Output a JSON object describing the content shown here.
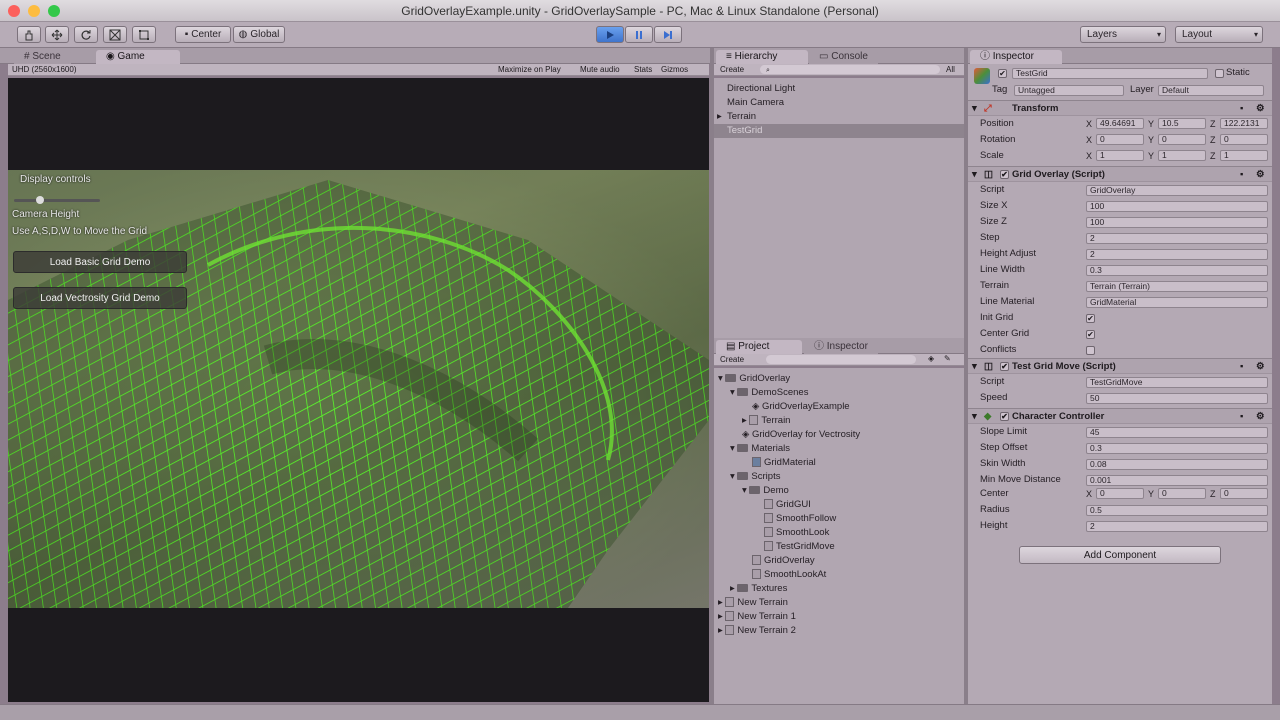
{
  "window": {
    "title": "GridOverlayExample.unity - GridOverlaySample - PC, Mac & Linux Standalone (Personal)"
  },
  "toolbar": {
    "pivot": "Center",
    "space": "Global",
    "layers": "Layers",
    "layout": "Layout"
  },
  "scene_tabs": {
    "scene": "Scene",
    "game": "Game"
  },
  "game_bar": {
    "resolution": "UHD (2560x1600)",
    "maximize": "Maximize on Play",
    "mute": "Mute audio",
    "stats": "Stats",
    "gizmos": "Gizmos"
  },
  "game_hud": {
    "display_controls": "Display controls",
    "camera_height": "Camera Height",
    "move_hint": "Use A,S,D,W to Move the Grid",
    "btn_basic": "Load Basic Grid Demo",
    "btn_vectrosity": "Load Vectrosity Grid Demo",
    "camera_slider_level": 0.3
  },
  "hierarchy": {
    "tab": "Hierarchy",
    "tab2": "Console",
    "create": "Create",
    "search_placeholder": "All",
    "items": [
      "Directional Light",
      "Main Camera",
      "Terrain",
      "TestGrid"
    ]
  },
  "project": {
    "tab": "Project",
    "tab2": "Inspector",
    "create": "Create",
    "tree": [
      "GridOverlay",
      "DemoScenes",
      "GridOverlayExample",
      "Terrain",
      "GridOverlay for Vectrosity",
      "Materials",
      "GridMaterial",
      "Scripts",
      "Demo",
      "GridGUI",
      "SmoothFollow",
      "SmoothLook",
      "TestGridMove",
      "GridOverlay",
      "SmoothLookAt",
      "Textures",
      "New Terrain",
      "New Terrain 1",
      "New Terrain 2"
    ]
  },
  "inspector": {
    "tab": "Inspector",
    "object_name": "TestGrid",
    "static_label": "Static",
    "tag_label": "Tag",
    "tag_value": "Untagged",
    "layer_label": "Layer",
    "layer_value": "Default",
    "transform": {
      "title": "Transform",
      "position_label": "Position",
      "rotation_label": "Rotation",
      "scale_label": "Scale",
      "position": [
        "49.64691",
        "10.5",
        "122.2131"
      ],
      "rotation": [
        "0",
        "0",
        "0"
      ],
      "scale": [
        "1",
        "1",
        "1"
      ]
    },
    "grid_overlay": {
      "title": "Grid Overlay (Script)",
      "fields": [
        {
          "label": "Script",
          "value": "GridOverlay"
        },
        {
          "label": "Size X",
          "value": "100"
        },
        {
          "label": "Size Z",
          "value": "100"
        },
        {
          "label": "Step",
          "value": "2"
        },
        {
          "label": "Height Adjust",
          "value": "2"
        },
        {
          "label": "Line Width",
          "value": "0.3"
        },
        {
          "label": "Terrain",
          "value": "Terrain (Terrain)"
        },
        {
          "label": "Line Material",
          "value": "GridMaterial"
        }
      ],
      "checks": [
        {
          "label": "Init Grid",
          "value": "✔"
        },
        {
          "label": "Center Grid",
          "value": "✔"
        },
        {
          "label": "Conflicts",
          "value": ""
        }
      ]
    },
    "test_grid_move": {
      "title": "Test Grid Move (Script)",
      "fields": [
        {
          "label": "Script",
          "value": "TestGridMove"
        },
        {
          "label": "Speed",
          "value": "50"
        }
      ]
    },
    "character_controller": {
      "title": "Character Controller",
      "fields": [
        {
          "label": "Slope Limit",
          "value": "45"
        },
        {
          "label": "Step Offset",
          "value": "0.3"
        },
        {
          "label": "Skin Width",
          "value": "0.08"
        },
        {
          "label": "Min Move Distance",
          "value": "0.001"
        }
      ],
      "center_label": "Center",
      "center": [
        "0",
        "0",
        "0"
      ],
      "fields2": [
        {
          "label": "Radius",
          "value": "0.5"
        },
        {
          "label": "Height",
          "value": "2"
        }
      ]
    },
    "add_component": "Add Component"
  },
  "colors": {
    "chrome": "#b7acb7",
    "grid": "#5aff2a",
    "terrain": "#7e8f66"
  }
}
